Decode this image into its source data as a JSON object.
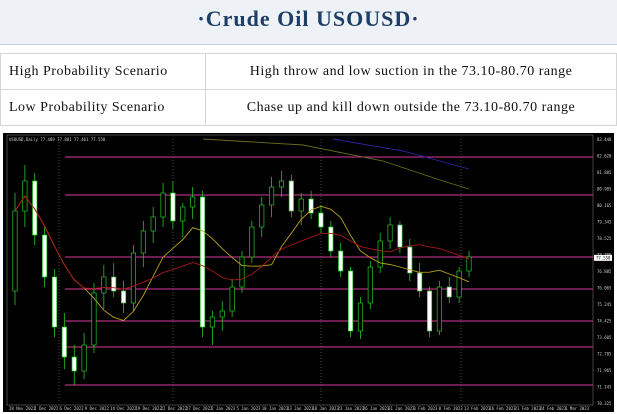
{
  "header": {
    "title": "·Crude  Oil  USOUSD·"
  },
  "scenarios": [
    {
      "label": "High Probability Scenario",
      "text": "High throw and low suction in the 73.10-80.70 range"
    },
    {
      "label": "Low Probability Scenario",
      "text": "Chase up and kill down outside the 73.10-80.70 range"
    }
  ],
  "chart_data": {
    "type": "candlestick",
    "instrument_label": "USOUSD,Daily  77.489 77.881 77.461 77.558",
    "price_labels": [
      "83.440",
      "82.620",
      "81.805",
      "80.985",
      "80.165",
      "79.345",
      "78.525",
      "77.705",
      "76.885",
      "76.065",
      "75.245",
      "74.425",
      "73.605",
      "72.785",
      "71.965",
      "71.145",
      "70.325"
    ],
    "current_price_label": "77.558",
    "date_labels": [
      "28 Nov 2022",
      "1 Dec 2022",
      "6 Dec 2022",
      "9 Dec 2022",
      "14 Dec 2022",
      "19 Dec 2022",
      "22 Dec 2022",
      "27 Dec 2022",
      "2 Jan 2023",
      "5 Jan 2023",
      "10 Jan 2023",
      "13 Jan 2023",
      "18 Jan 2023",
      "23 Jan 2023",
      "26 Jan 2023",
      "31 Jan 2023",
      "3 Feb 2023",
      "8 Feb 2023",
      "13 Feb 2023",
      "16 Feb 2023",
      "21 Feb 2023",
      "24 Feb 2023",
      "1 Mar 2023"
    ],
    "horizontal_levels": [
      82.6,
      80.7,
      77.6,
      76.0,
      74.4,
      73.1,
      71.2
    ],
    "candles": [
      [
        75.9,
        80.8,
        75.2,
        79.9
      ],
      [
        79.9,
        82.2,
        79.1,
        81.4
      ],
      [
        81.4,
        81.8,
        78.2,
        78.7
      ],
      [
        78.7,
        79.2,
        76.1,
        76.6
      ],
      [
        76.6,
        77.0,
        73.6,
        74.1
      ],
      [
        74.1,
        74.8,
        72.0,
        72.6
      ],
      [
        72.6,
        73.2,
        71.2,
        71.9
      ],
      [
        71.9,
        73.8,
        71.5,
        73.2
      ],
      [
        73.2,
        76.3,
        72.8,
        75.8
      ],
      [
        75.8,
        77.2,
        75.0,
        76.6
      ],
      [
        76.6,
        77.3,
        75.6,
        75.9
      ],
      [
        75.9,
        76.4,
        74.8,
        75.3
      ],
      [
        75.3,
        78.2,
        74.9,
        77.8
      ],
      [
        77.8,
        79.4,
        77.1,
        78.9
      ],
      [
        78.9,
        80.1,
        78.3,
        79.6
      ],
      [
        79.6,
        81.3,
        79.1,
        80.8
      ],
      [
        80.8,
        81.4,
        79.0,
        79.4
      ],
      [
        79.4,
        80.3,
        78.6,
        80.1
      ],
      [
        80.1,
        81.1,
        79.5,
        80.6
      ],
      [
        80.6,
        80.9,
        73.6,
        74.1
      ],
      [
        74.1,
        74.9,
        73.2,
        74.6
      ],
      [
        74.6,
        75.4,
        73.9,
        74.9
      ],
      [
        74.9,
        76.5,
        74.6,
        76.1
      ],
      [
        76.1,
        77.9,
        75.8,
        77.6
      ],
      [
        77.6,
        79.4,
        77.3,
        79.1
      ],
      [
        79.1,
        80.6,
        78.6,
        80.2
      ],
      [
        80.2,
        81.6,
        79.6,
        81.1
      ],
      [
        81.1,
        81.9,
        80.6,
        81.4
      ],
      [
        81.4,
        81.7,
        79.6,
        79.9
      ],
      [
        79.9,
        80.8,
        79.2,
        80.5
      ],
      [
        80.5,
        80.9,
        79.5,
        79.8
      ],
      [
        79.8,
        80.2,
        78.8,
        79.1
      ],
      [
        79.1,
        79.4,
        77.6,
        77.9
      ],
      [
        77.9,
        78.3,
        76.6,
        76.9
      ],
      [
        76.9,
        77.1,
        73.6,
        73.9
      ],
      [
        73.9,
        75.6,
        73.5,
        75.3
      ],
      [
        75.3,
        77.4,
        75.0,
        77.1
      ],
      [
        77.1,
        78.8,
        76.8,
        78.4
      ],
      [
        78.4,
        79.6,
        78.0,
        79.2
      ],
      [
        79.2,
        79.4,
        77.8,
        78.1
      ],
      [
        78.1,
        78.5,
        76.4,
        76.8
      ],
      [
        76.8,
        77.3,
        75.6,
        75.9
      ],
      [
        75.9,
        76.1,
        73.6,
        73.9
      ],
      [
        73.9,
        76.4,
        73.7,
        76.1
      ],
      [
        76.1,
        76.6,
        75.3,
        75.6
      ],
      [
        75.6,
        77.1,
        75.3,
        76.9
      ],
      [
        76.9,
        77.9,
        76.6,
        77.6
      ]
    ]
  }
}
